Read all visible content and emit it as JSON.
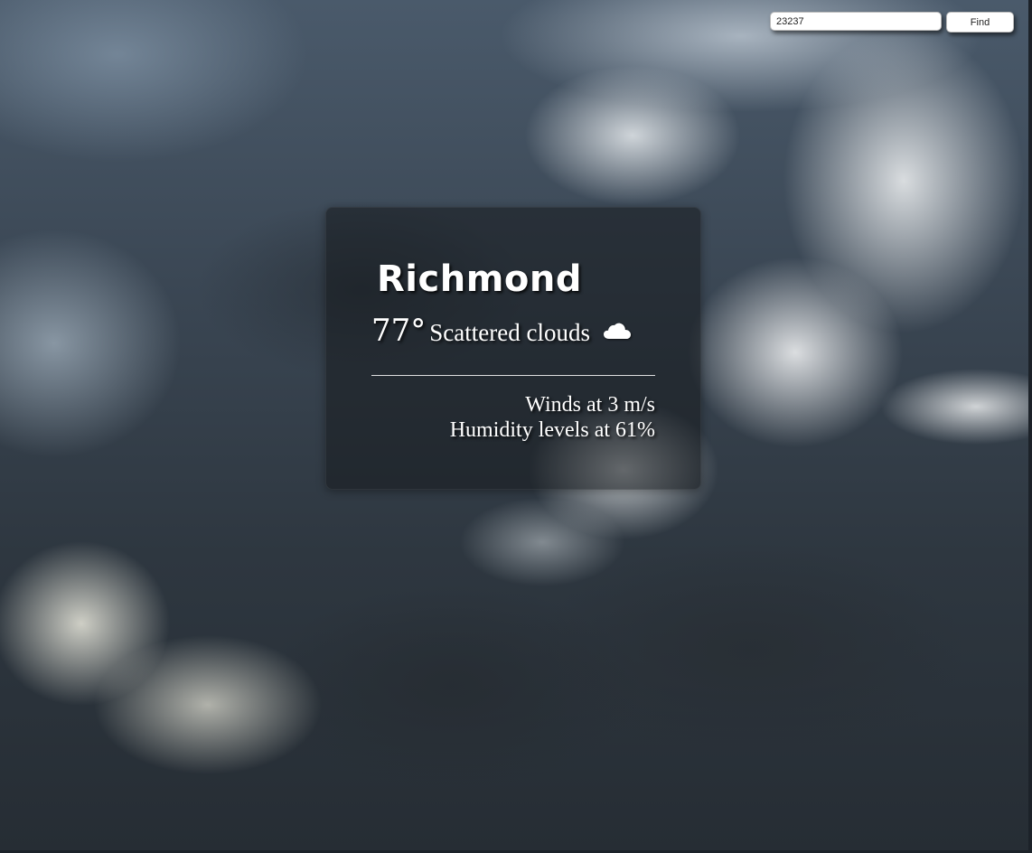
{
  "search": {
    "zip_value": "23237",
    "button_label": "Find"
  },
  "weather": {
    "city": "Richmond",
    "temperature": "77°",
    "condition": "Scattered clouds",
    "condition_icon": "cloud-icon",
    "wind": "Winds at 3 m/s",
    "humidity": "Humidity levels at 61%"
  },
  "colors": {
    "card_background": "#161a1e",
    "text": "#ffffff",
    "background_sky": "#3a4653"
  }
}
